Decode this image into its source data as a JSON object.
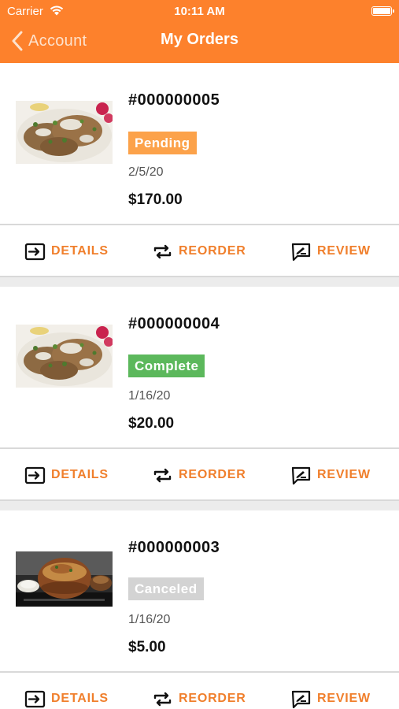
{
  "status_bar": {
    "carrier": "Carrier",
    "time": "10:11 AM"
  },
  "nav": {
    "back_label": "Account",
    "title": "My Orders"
  },
  "actions": {
    "details": "DETAILS",
    "reorder": "REORDER",
    "review": "REVIEW"
  },
  "colors": {
    "brand": "#fd812c",
    "accent_text": "#f07f2c",
    "pending": "#fca24a",
    "complete": "#5cb85c",
    "canceled": "#d3d3d3"
  },
  "orders": [
    {
      "number": "#000000005",
      "status": "Pending",
      "date": "2/5/20",
      "total": "$170.00",
      "image": "grilled-chicken"
    },
    {
      "number": "#000000004",
      "status": "Complete",
      "date": "1/16/20",
      "total": "$20.00",
      "image": "grilled-chicken"
    },
    {
      "number": "#000000003",
      "status": "Canceled",
      "date": "1/16/20",
      "total": "$5.00",
      "image": "biryani-pot"
    }
  ]
}
